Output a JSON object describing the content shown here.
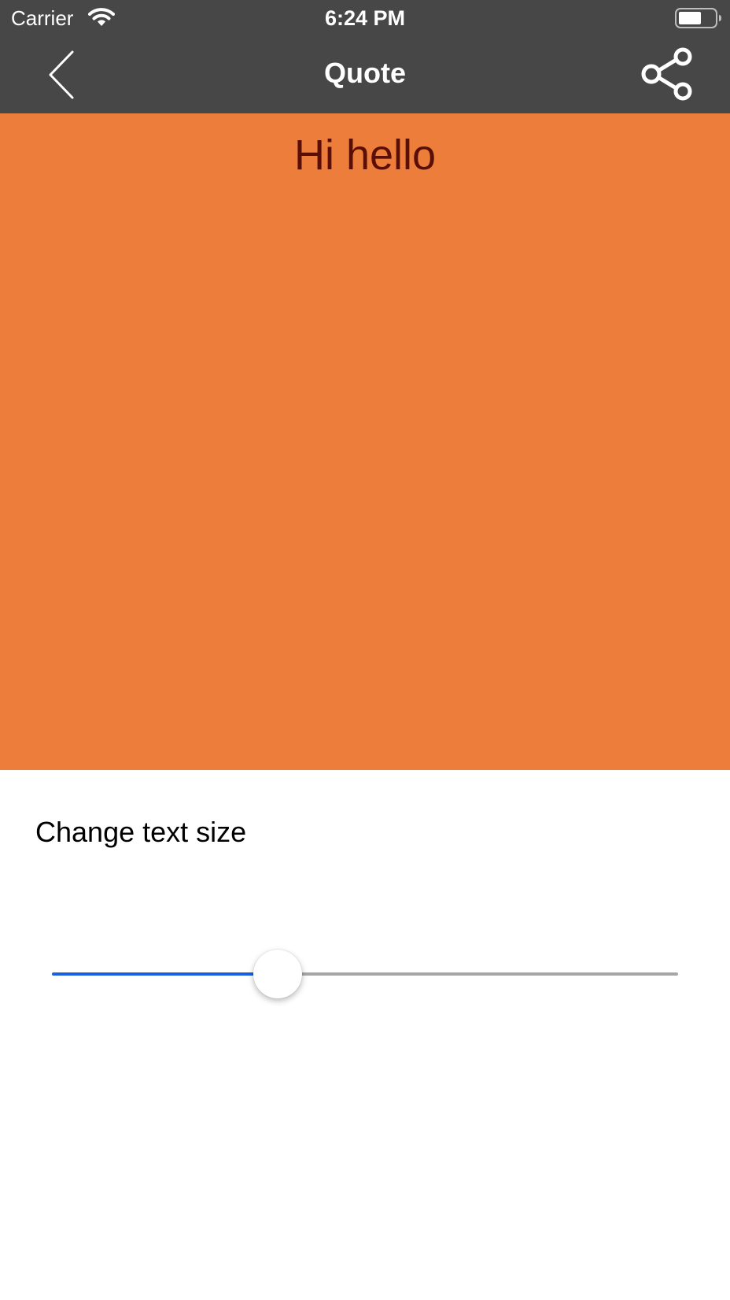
{
  "status_bar": {
    "carrier": "Carrier",
    "time": "6:24 PM",
    "wifi_icon": "wifi-icon",
    "battery_icon": "battery-icon"
  },
  "nav": {
    "title": "Quote",
    "back_icon": "chevron-left-icon",
    "share_icon": "share-icon"
  },
  "quote": {
    "text": "Hi hello",
    "background_color": "#ed7d3b",
    "text_color": "#5a0f06"
  },
  "settings": {
    "text_size_label": "Change text size"
  },
  "slider": {
    "value_fraction": 0.36,
    "min_track_color": "#1a5fe0",
    "max_track_color": "#a6a6a6"
  },
  "colors": {
    "nav_background": "#474747",
    "page_background": "#ffffff"
  }
}
